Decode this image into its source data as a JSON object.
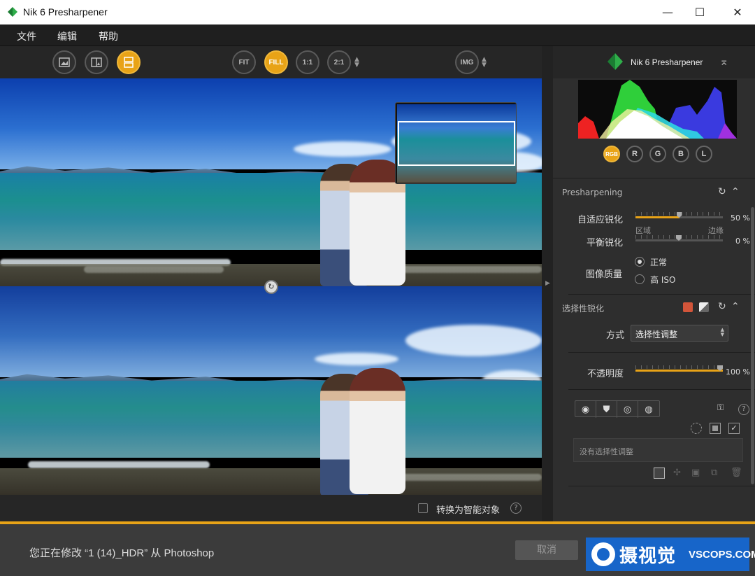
{
  "window": {
    "title": "Nik 6 Presharpener",
    "minimize": "—",
    "maximize": "☐",
    "close": "✕"
  },
  "menu": [
    "文件",
    "编辑",
    "帮助"
  ],
  "toolbar": {
    "view_buttons": [
      "single-view",
      "split-view",
      "compare-view"
    ],
    "zoom_buttons": [
      "FIT",
      "FILL",
      "1:1",
      "2:1"
    ],
    "active_zoom": "FILL",
    "img_button": "IMG",
    "updown": "▲▼"
  },
  "preview": {
    "split_handle": "↻",
    "smart_object_label": "转换为智能对象",
    "help": "?"
  },
  "panel": {
    "brand": "Nik 6 Presharpener",
    "collapse": "⌅",
    "channels": [
      "RGB",
      "R",
      "G",
      "B",
      "L"
    ],
    "active_channel": "RGB",
    "presharpening": {
      "title": "Presharpening",
      "reset": "↻",
      "collapse": "⌃",
      "adaptive_label": "自适应锐化",
      "adaptive_value": "50 %",
      "adaptive_percent": 50,
      "region_label": "区域",
      "edge_label": "边缘",
      "balance_label": "平衡锐化",
      "balance_value": "0 %",
      "balance_percent": 0,
      "quality_label": "图像质量",
      "quality_options": [
        "正常",
        "高 ISO"
      ],
      "quality_selected": "正常"
    },
    "selective": {
      "title": "选择性锐化",
      "reset": "↻",
      "collapse": "⌃",
      "method_label": "方式",
      "method_value": "选择性调整",
      "opacity_label": "不透明度",
      "opacity_value": "100 %",
      "opacity_percent": 100,
      "empty_text": "没有选择性调整",
      "help": "?"
    }
  },
  "bottom": {
    "status": "您正在修改 “1 (14)_HDR” 从 Photoshop",
    "cancel": "取消",
    "watermark_text": "摄视觉",
    "watermark_url": "VSCOPS.COM"
  },
  "colors": {
    "accent": "#e8a317",
    "swatch_red": "#d2553a",
    "watermark_bg": "#1765c9"
  }
}
